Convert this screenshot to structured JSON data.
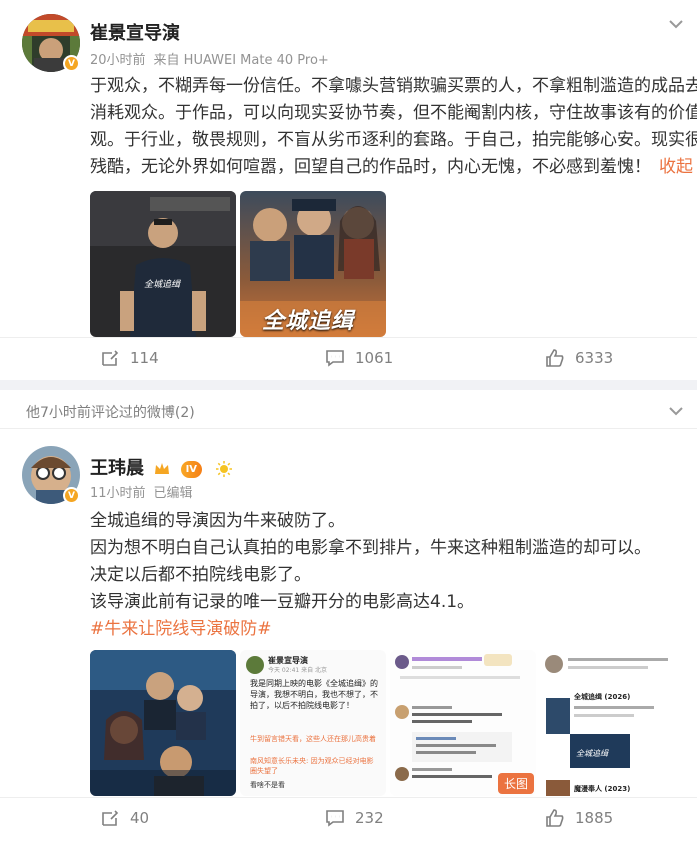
{
  "post1": {
    "username": "崔景宣导演",
    "time": "20小时前",
    "source": "来自 HUAWEI Mate 40 Pro+",
    "lines": [
      "于观众，不糊弄每一份信任。不拿噱头营销欺骗买票的人，不拿粗制滥造的成品去",
      "消耗观众。于作品，可以向现实妥协节奏，但不能阉割内核，守住故事该有的价值",
      "观。于行业，敬畏规则，不盲从劣币逐利的套路。于自己，拍完能够心安。现实很",
      "残酷，无论外界如何喧嚣，回望自己的作品时，内心无愧，不必感到羞愧！"
    ],
    "fold_label": "收起",
    "image1_caption": "全城追缉",
    "image2_caption": "全城追缉",
    "repost_count": "114",
    "comment_count": "1061",
    "like_count": "6333"
  },
  "commented_header": "他7小时前评论过的微博(2)",
  "post2": {
    "username": "王玮晨",
    "level": "IV",
    "time": "11小时前",
    "edited": "已编辑",
    "lines": [
      "全城追缉的导演因为牛来破防了。",
      "因为想不明白自己认真拍的电影拿不到排片，牛来这种粗制滥造的却可以。",
      "决定以后都不拍院线电影了。",
      "该导演此前有记录的唯一豆瓣开分的电影高达4.1。"
    ],
    "hashtag": "#牛来让院线导演破防#",
    "thumb2": {
      "name": "崔景宣导演",
      "time": "今天 02:41 来自 北京",
      "text": "我是同期上映的电影《全城追缉》的导演，我想不明白，我也不想了，不拍了，以后不拍院线电影了！",
      "c1": "牛到留言错天看，这些人还在那儿高贵着",
      "c2": "南风知意长乐未央: 因为观众已经对电影圈失望了",
      "c3": "看啥不是看"
    },
    "thumb4": {
      "title1": "全城追缉 (2026)",
      "poster_text": "全城追缉",
      "title2": "魔漫奉人 (2023)"
    },
    "long_label": "长图",
    "repost_count": "40",
    "comment_count": "232",
    "like_count": "1885"
  },
  "colors": {
    "accent": "#eb7340",
    "gold": "#f5a623",
    "meta": "#939393"
  }
}
